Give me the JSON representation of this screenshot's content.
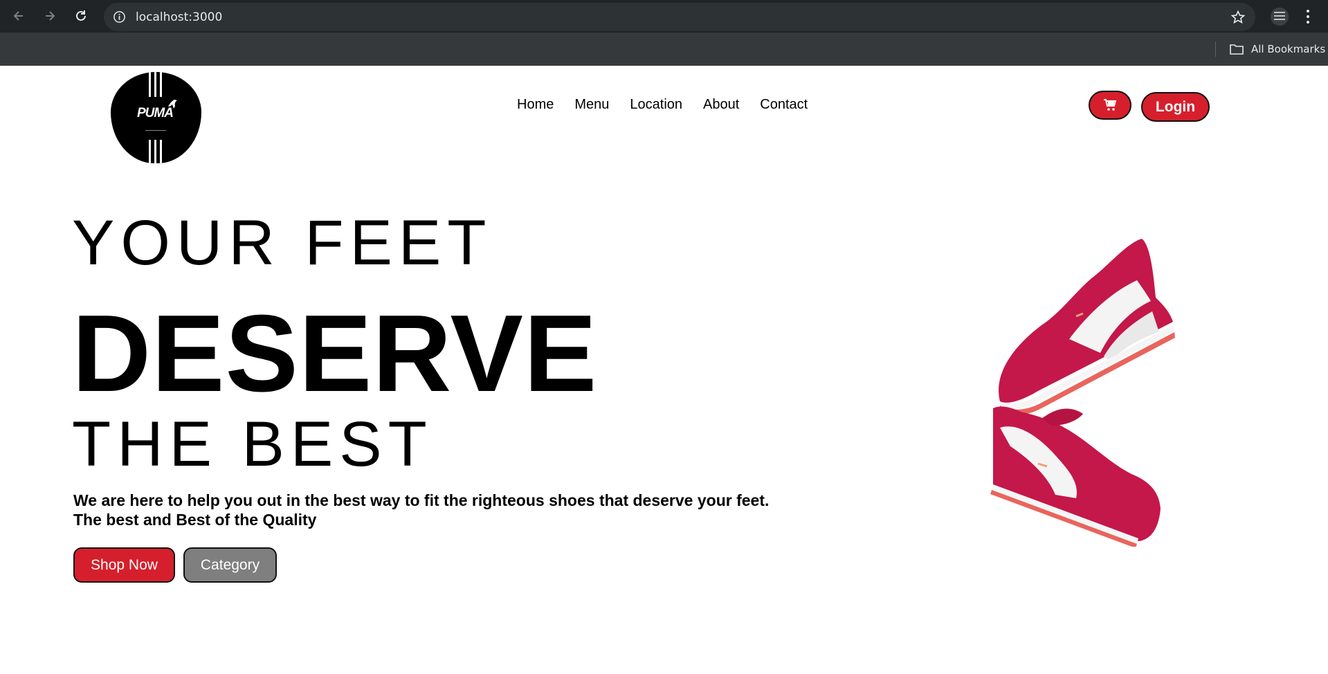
{
  "browser": {
    "url": "localhost:3000",
    "bookmarks_label": "All Bookmarks"
  },
  "logo": {
    "text": "PUMA"
  },
  "nav": {
    "items": [
      "Home",
      "Menu",
      "Location",
      "About",
      "Contact"
    ]
  },
  "header": {
    "cart_icon": "cart-icon",
    "login_label": "Login"
  },
  "hero": {
    "line1": "YOUR FEET",
    "line2": "DESERVE",
    "line3": "THE BEST",
    "description": "We are here to help you out in the best way to fit the righteous shoes that deserve your feet. The best and Best of the Quality",
    "shop_now_label": "Shop Now",
    "category_label": "Category",
    "image": "red-puma-sneakers"
  },
  "colors": {
    "accent": "#d61f2c",
    "secondary_button": "#7f7f7f",
    "chrome_bg": "#35393c",
    "toolbar_bg": "#202426"
  }
}
